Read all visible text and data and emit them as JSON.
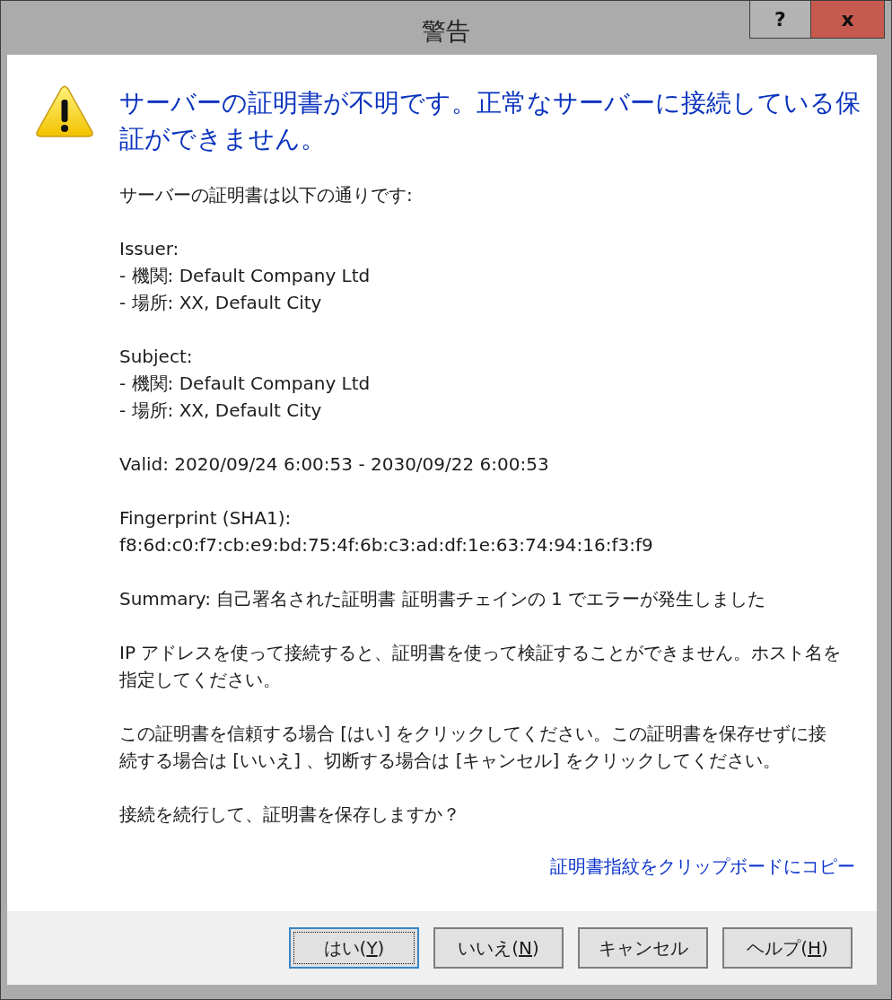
{
  "window": {
    "title": "警告",
    "controls": [
      {
        "kind": "help",
        "label": "?"
      },
      {
        "kind": "close",
        "label": "x"
      }
    ]
  },
  "message": {
    "heading_lines": [
      "サーバーの証明書が不明です。正常なサーバーに接続している保",
      "証ができません。"
    ],
    "paragraphs": [
      {
        "lines": [
          "サーバーの証明書は以下の通りです:"
        ]
      },
      {
        "lines": [
          "Issuer:",
          "- 機関: Default Company Ltd",
          "- 場所: XX, Default City"
        ]
      },
      {
        "lines": [
          "Subject:",
          "- 機関: Default Company Ltd",
          "- 場所: XX, Default City"
        ]
      },
      {
        "lines": [
          "Valid: 2020/09/24 6:00:53 - 2030/09/22 6:00:53"
        ]
      },
      {
        "lines": [
          "Fingerprint (SHA1):",
          "f8:6d:c0:f7:cb:e9:bd:75:4f:6b:c3:ad:df:1e:63:74:94:16:f3:f9"
        ]
      },
      {
        "lines": [
          "Summary: 自己署名された証明書 証明書チェインの 1 でエラーが発生しました"
        ]
      },
      {
        "lines": [
          "IP アドレスを使って接続すると、証明書を使って検証することができません。ホスト名を",
          "指定してください。"
        ]
      },
      {
        "lines": [
          "この証明書を信頼する場合 [はい] をクリックしてください。この証明書を保存せずに接",
          "続する場合は [いいえ] 、切断する場合は [キャンセル] をクリックしてください。"
        ]
      },
      {
        "lines": [
          "接続を続行して、証明書を保存しますか？"
        ]
      }
    ],
    "link": "証明書指紋をクリップボードにコピー"
  },
  "buttons": [
    {
      "label": "はい(",
      "access_key": "Y",
      "label_end": ")",
      "focused": true
    },
    {
      "label": "いいえ(",
      "access_key": "N",
      "label_end": ")",
      "focused": false
    },
    {
      "label": "キャンセル",
      "focused": false
    },
    {
      "label": "ヘルプ(",
      "access_key": "H",
      "label_end": ")",
      "focused": false
    }
  ]
}
